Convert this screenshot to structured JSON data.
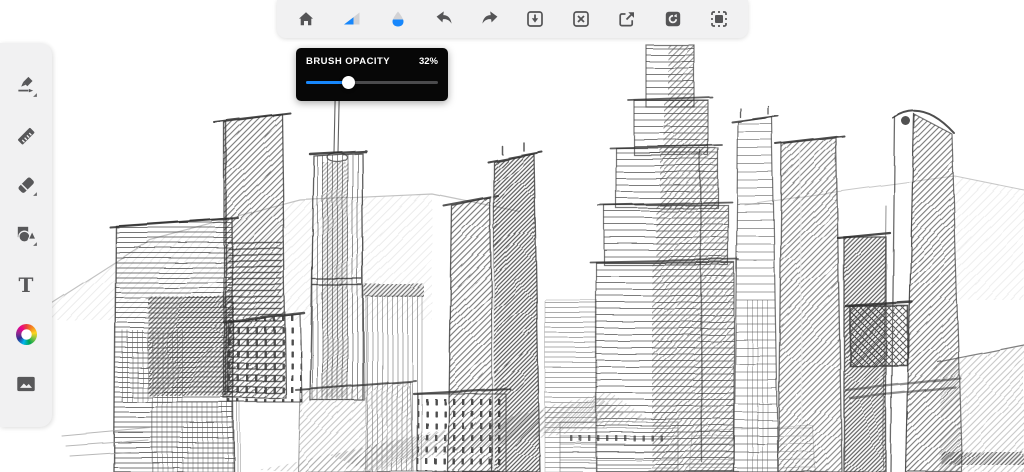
{
  "app": {
    "name": "drawing-app",
    "colors": {
      "accent_blue": "#1787fc",
      "panel_bg": "#f1f1f2",
      "icon_gray": "#545456",
      "popup_bg": "#070707",
      "slider_track": "#4b4b4d",
      "slider_thumb": "#ffffff"
    }
  },
  "toolbar": {
    "icons": [
      "home",
      "brush-size",
      "brush-opacity",
      "undo",
      "redo",
      "save",
      "clear-canvas",
      "export",
      "reset",
      "fit-canvas"
    ]
  },
  "brush_popup": {
    "label": "BRUSH OPACITY",
    "value": "32%",
    "percent": 32
  },
  "sidebar": {
    "tools": [
      {
        "name": "draw",
        "has_flyout": true
      },
      {
        "name": "ruler",
        "has_flyout": false
      },
      {
        "name": "eraser",
        "has_flyout": true
      },
      {
        "name": "shapes",
        "has_flyout": true
      },
      {
        "name": "text",
        "glyph": "T",
        "has_flyout": false
      },
      {
        "name": "color",
        "has_flyout": false
      },
      {
        "name": "image",
        "has_flyout": false
      }
    ]
  },
  "canvas": {
    "description": "Pencil sketch of a downtown city skyline: hatched skyscrapers, a stepped central tower with spire towers, low-rise blocks in the foreground and a faint mountain ridge behind."
  }
}
